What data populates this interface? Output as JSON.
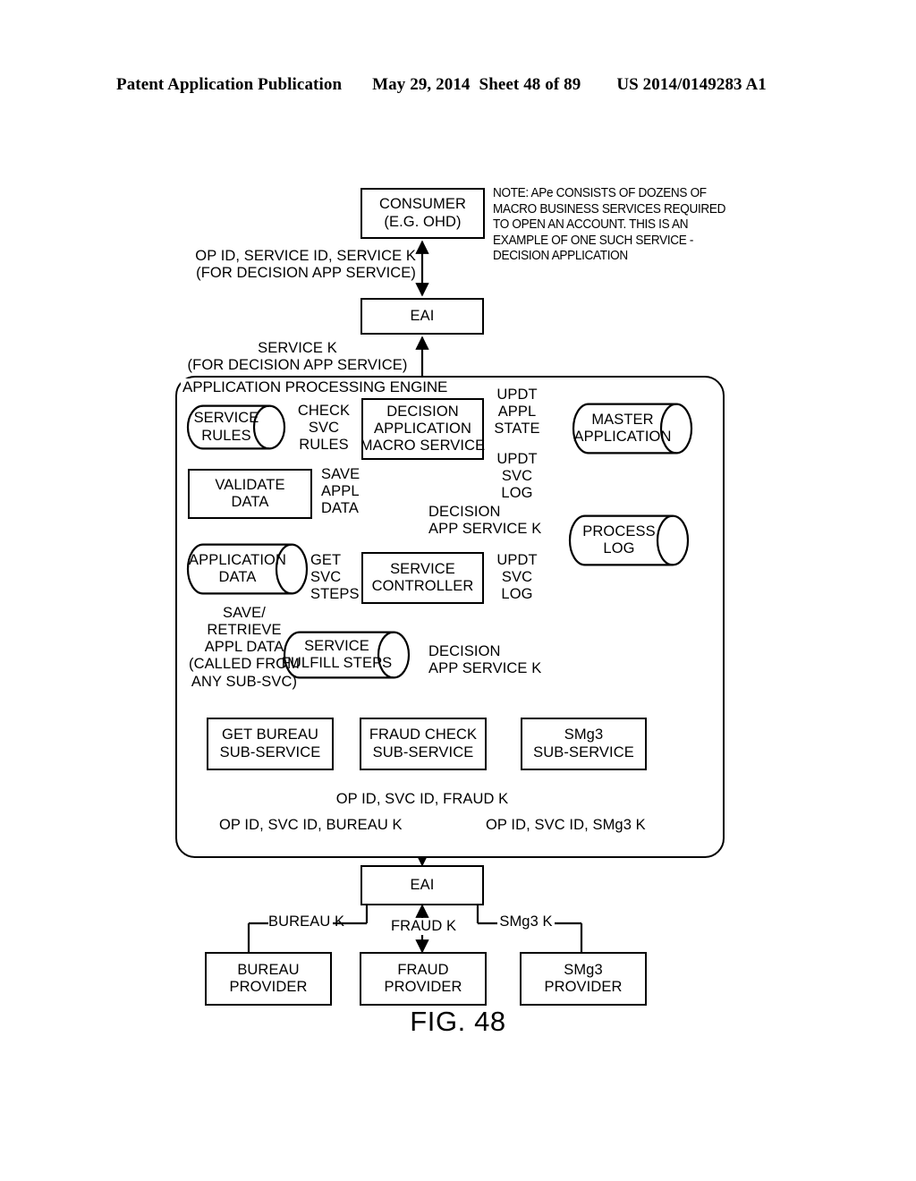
{
  "header": {
    "title": "Patent Application Publication",
    "date": "May 29, 2014",
    "sheet": "Sheet 48 of 89",
    "publication_number": "US 2014/0149283 A1"
  },
  "figure": {
    "caption": "FIG. 48"
  },
  "note": {
    "lines": [
      "NOTE: APe CONSISTS OF DOZENS OF",
      "MACRO BUSINESS SERVICES REQUIRED",
      "TO OPEN AN ACCOUNT. THIS IS AN",
      "EXAMPLE OF ONE SUCH SERVICE -",
      "DECISION APPLICATION"
    ]
  },
  "nodes": {
    "consumer": {
      "line1": "CONSUMER",
      "line2": "(E.G. OHD)"
    },
    "eai_top": {
      "line1": "EAI"
    },
    "ape": {
      "title": "APPLICATION PROCESSING ENGINE"
    },
    "service_rules": {
      "line1": "SERVICE",
      "line2": "RULES"
    },
    "validate_data": {
      "line1": "VALIDATE",
      "line2": "DATA"
    },
    "application_data": {
      "line1": "APPLICATION",
      "line2": "DATA"
    },
    "decision_macro": {
      "line1": "DECISION",
      "line2": "APPLICATION",
      "line3": "MACRO SERVICE"
    },
    "master_application": {
      "line1": "MASTER",
      "line2": "APPLICATION"
    },
    "process_log": {
      "line1": "PROCESS",
      "line2": "LOG"
    },
    "service_controller": {
      "line1": "SERVICE",
      "line2": "CONTROLLER"
    },
    "service_fulfill_steps": {
      "line1": "SERVICE",
      "line2": "FULFILL STEPS"
    },
    "get_bureau_sub": {
      "line1": "GET BUREAU",
      "line2": "SUB-SERVICE"
    },
    "fraud_check_sub": {
      "line1": "FRAUD CHECK",
      "line2": "SUB-SERVICE"
    },
    "smg3_sub": {
      "line1": "SMg3",
      "line2": "SUB-SERVICE"
    },
    "eai_bottom": {
      "line1": "EAI"
    },
    "bureau_provider": {
      "line1": "BUREAU",
      "line2": "PROVIDER"
    },
    "fraud_provider": {
      "line1": "FRAUD",
      "line2": "PROVIDER"
    },
    "smg3_provider": {
      "line1": "SMg3",
      "line2": "PROVIDER"
    }
  },
  "edge_labels": {
    "op_id_service_id_service_k": {
      "line1": "OP ID, SERVICE ID, SERVICE K",
      "line2": "(FOR DECISION APP SERVICE)"
    },
    "service_k_for_decision": {
      "line1": "SERVICE K",
      "line2": "(FOR DECISION APP SERVICE)"
    },
    "check_svc_rules": {
      "line1": "CHECK",
      "line2": "SVC",
      "line3": "RULES"
    },
    "save_appl_data": {
      "line1": "SAVE",
      "line2": "APPL",
      "line3": "DATA"
    },
    "get_svc_steps": {
      "line1": "GET",
      "line2": "SVC",
      "line3": "STEPS"
    },
    "updt_appl_state": {
      "line1": "UPDT",
      "line2": "APPL",
      "line3": "STATE"
    },
    "updt_svc_log_upper": {
      "line1": "UPDT",
      "line2": "SVC",
      "line3": "LOG"
    },
    "updt_svc_log_lower": {
      "line1": "UPDT",
      "line2": "SVC",
      "line3": "LOG"
    },
    "decision_app_service_k_mid": {
      "line1": "DECISION",
      "line2": "APP SERVICE K"
    },
    "decision_app_service_k_low": {
      "line1": "DECISION",
      "line2": "APP SERVICE K"
    },
    "save_retrieve_appl_data": {
      "line1": "SAVE/",
      "line2": "RETRIEVE",
      "line3": "APPL DATA",
      "line4": "(CALLED FROM",
      "line5": "ANY SUB-SVC)"
    },
    "op_id_svc_id_fraud_k": "OP ID, SVC ID, FRAUD K",
    "op_id_svc_id_bureau_k": "OP ID, SVC ID, BUREAU K",
    "op_id_svc_id_smg3_k": "OP ID, SVC ID, SMg3 K",
    "bureau_k": "BUREAU K",
    "fraud_k": "FRAUD K",
    "smg3_k": "SMg3 K"
  },
  "colors": {
    "ink": "#000000",
    "paper": "#ffffff"
  }
}
